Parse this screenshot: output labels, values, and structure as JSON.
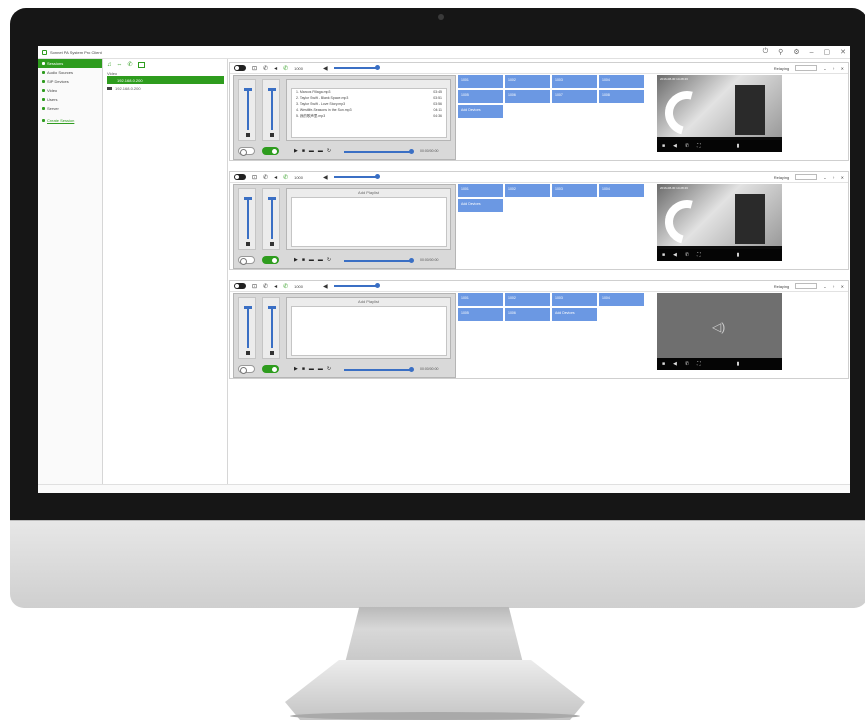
{
  "window": {
    "title": "Sonnet PA System Pro Client",
    "controls": [
      "⏻",
      "⚲",
      "⚙",
      "–",
      "▢",
      "✕"
    ]
  },
  "nav": {
    "items": [
      {
        "label": "Sessions",
        "active": true
      },
      {
        "label": "Audio Sources",
        "active": false
      },
      {
        "label": "SIP Devices",
        "active": false
      },
      {
        "label": "Video",
        "active": false
      },
      {
        "label": "Users",
        "active": false
      },
      {
        "label": "Server",
        "active": false
      }
    ],
    "link": "Create Session"
  },
  "tree": {
    "group": "Video",
    "selected": "192.168.0.200",
    "node": "192.168.0.200"
  },
  "sessions": [
    {
      "extension": "1000",
      "status": "Relaying",
      "playlist_title": "",
      "songs": [
        {
          "name": "1. Marcos Fillaga.mp3",
          "time": "03:45"
        },
        {
          "name": "2. Taylor Swift - Blank Space.mp3",
          "time": "03:51"
        },
        {
          "name": "3. Taylor Swift - Love Story.mp3",
          "time": "03:56"
        },
        {
          "name": "4. Westlife-Seasons in the Sun.mp3",
          "time": "04:11"
        },
        {
          "name": "5. 我的歌声里.mp3",
          "time": "04:36"
        }
      ],
      "tiles": [
        "1001",
        "1002",
        "1003",
        "1004",
        "1005",
        "1006",
        "1007",
        "1008",
        "Add Devices"
      ],
      "timecode": "00:00/00:00",
      "preview": "camera",
      "stamp": "2016-08-30 14:28:46"
    },
    {
      "extension": "1000",
      "status": "Relaying",
      "playlist_title": "Add Playlist",
      "songs": [],
      "tiles": [
        "1001",
        "1002",
        "1003",
        "1004",
        "Add Devices"
      ],
      "timecode": "00:00/00:00",
      "preview": "camera",
      "stamp": "2016-08-30 14:28:46"
    },
    {
      "extension": "1000",
      "status": "Relaying",
      "playlist_title": "Add Playlist",
      "songs": [],
      "tiles": [
        "1001",
        "1002",
        "1003",
        "1004",
        "1005",
        "1006",
        "Add Devices"
      ],
      "timecode": "00:00/00:00",
      "preview": "audio",
      "stamp": ""
    }
  ],
  "colors": {
    "accent": "#2e9c1e",
    "tile": "#6b98e3",
    "slider": "#3a6fc4"
  }
}
